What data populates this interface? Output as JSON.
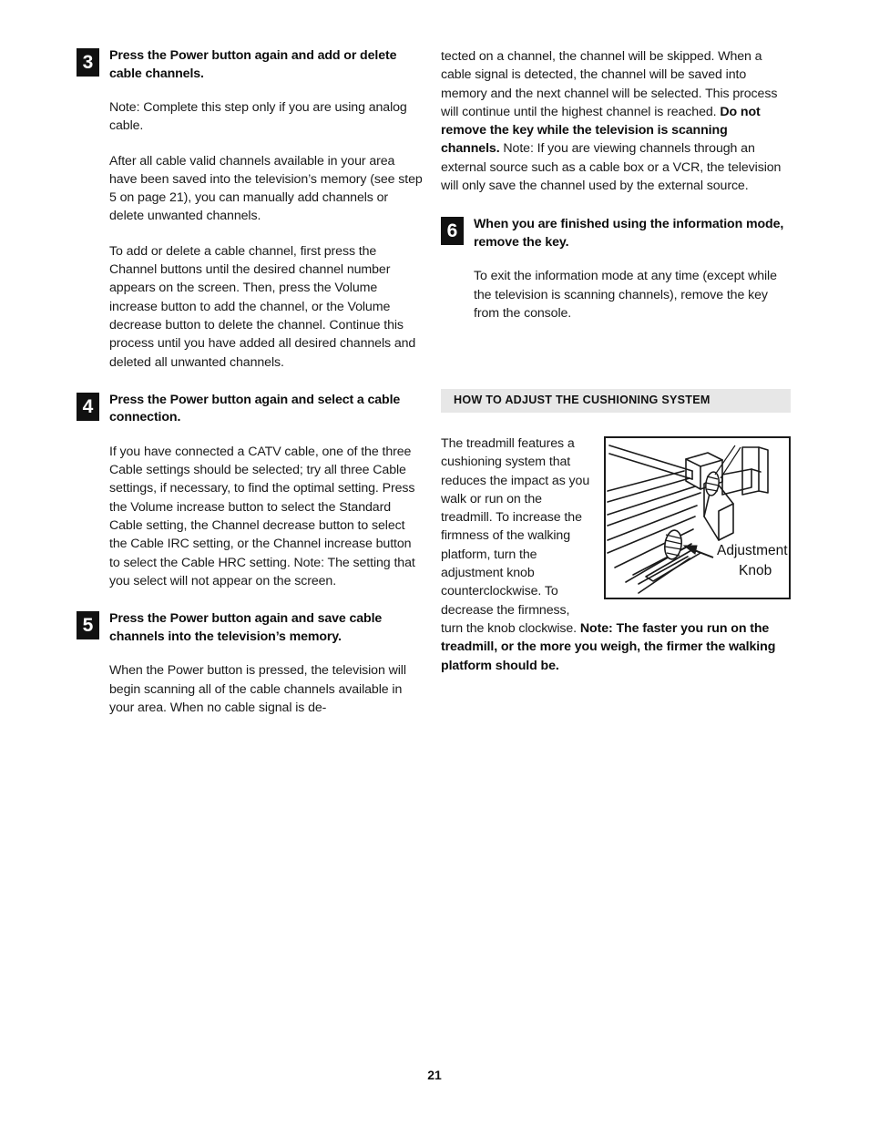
{
  "page": {
    "number": "21"
  },
  "left_column": {
    "steps": [
      {
        "badge": "3",
        "title": "Press the Power button again and add or delete cable channels.",
        "paragraphs": [
          "Note: Complete this step only if you are using analog cable.",
          "After all cable valid channels available in your area have been saved into the television’s memory (see step 5 on page 21), you can manually add channels or delete unwanted channels.",
          "To add or delete a cable channel, first press the Channel buttons until the desired channel number appears on the screen. Then, press the Volume increase button to add the channel, or the Volume decrease button to delete the channel. Continue this process until you have added all desired channels and deleted all unwanted channels."
        ]
      },
      {
        "badge": "4",
        "title": "Press the Power button again and select a cable connection.",
        "paragraphs": [
          "If you have connected a CATV cable, one of the three Cable settings should be selected; try all three Cable settings, if necessary, to find the optimal setting. Press the Volume increase button to select the Standard Cable setting, the Channel decrease button to select the Cable IRC setting, or the Channel increase button to select the Cable HRC setting. Note: The setting that you select will not appear on the screen."
        ]
      },
      {
        "badge": "5",
        "title": "Press the Power button again and save cable channels into the television’s memory.",
        "paragraphs": [
          "When the Power button is pressed, the television will begin scanning all of the cable channels available in your area. When no cable signal is de-"
        ]
      }
    ]
  },
  "right_column": {
    "continuation": {
      "text_before_bold": "tected on a channel, the channel will be skipped. When a cable signal is detected, the channel will be saved into memory and the next channel will be selected. This process will continue until the highest channel is reached. ",
      "bold_text": "Do not remove the key while the television is scanning channels.",
      "text_after_bold": " Note: If you are viewing channels through an external source such as a cable box or a VCR, the television will only save the channel used by the external source."
    },
    "steps": [
      {
        "badge": "6",
        "title": "When you are finished using the information mode, remove the key.",
        "paragraphs": [
          "To exit the information mode at any time (except while the television is scanning channels), remove the key from the console."
        ]
      }
    ],
    "section_header": "HOW TO ADJUST THE CUSHIONING SYSTEM",
    "cushioning": {
      "text_before_bold": "The treadmill features a cushioning system that reduces the impact as you walk or run on the treadmill. To increase the firmness of the walking platform, turn the adjustment knob counterclockwise. To decrease the firmness, turn the knob clockwise. ",
      "bold_text": "Note: The faster you run on the treadmill, or the more you weigh, the firmer the walking platform should be."
    },
    "figure": {
      "label_line1": "Adjustment",
      "label_line2": "Knob",
      "caption_name": "treadmill-cushioning-adjustment-knob-diagram"
    }
  }
}
